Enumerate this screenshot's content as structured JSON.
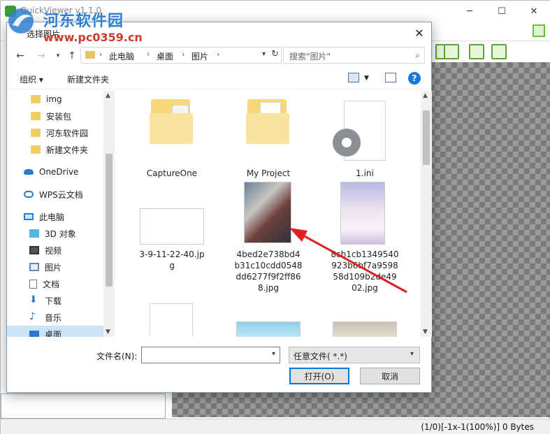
{
  "app": {
    "title": "QuickViewer v1.1.0",
    "status": "(1/0)[-1x-1(100%)] 0 Bytes"
  },
  "watermark": {
    "name": "河东软件园",
    "url": "www.pc0359.cn"
  },
  "dialog": {
    "title": "选择图片",
    "breadcrumb": [
      "此电脑",
      "桌面",
      "图片"
    ],
    "search_placeholder": "搜索\"图片\"",
    "organize": "组织 ▾",
    "new_folder": "新建文件夹",
    "nav_items": [
      {
        "label": "img",
        "icon": "folder-icon"
      },
      {
        "label": "安装包",
        "icon": "folder-icon"
      },
      {
        "label": "河东软件园",
        "icon": "folder-icon"
      },
      {
        "label": "新建文件夹",
        "icon": "folder-icon"
      },
      {
        "label": "OneDrive",
        "icon": "onedrive-icon"
      },
      {
        "label": "WPS云文档",
        "icon": "wps-cloud-icon"
      },
      {
        "label": "此电脑",
        "icon": "computer-icon"
      },
      {
        "label": "3D 对象",
        "icon": "3d-objects-icon"
      },
      {
        "label": "视频",
        "icon": "video-icon"
      },
      {
        "label": "图片",
        "icon": "pictures-icon"
      },
      {
        "label": "文档",
        "icon": "documents-icon"
      },
      {
        "label": "下载",
        "icon": "download-icon"
      },
      {
        "label": "音乐",
        "icon": "music-icon"
      },
      {
        "label": "桌面",
        "icon": "desktop-icon"
      }
    ],
    "files": [
      {
        "label": "CaptureOne",
        "icon": "folder-icon"
      },
      {
        "label": "My Project",
        "icon": "folder-icon"
      },
      {
        "label": "1.ini",
        "icon": "settings-file-icon"
      },
      {
        "label": "3-9-11-22-40.jp\ng",
        "icon": "image-thumbnail"
      },
      {
        "label": "4bed2e738bd4\nb31c10cdd0548\ndd6277f9f2ff86\n8.jpg",
        "icon": "image-thumbnail"
      },
      {
        "label": "8cb1cb1349540\n923b6bf7a9598\n58d109b2de49\n02.jpg",
        "icon": "image-thumbnail"
      }
    ],
    "filename_label": "文件名(N):",
    "filename_value": "",
    "filetype": "任意文件( *.*)",
    "open_button": "打开(O)",
    "cancel_button": "取消"
  }
}
